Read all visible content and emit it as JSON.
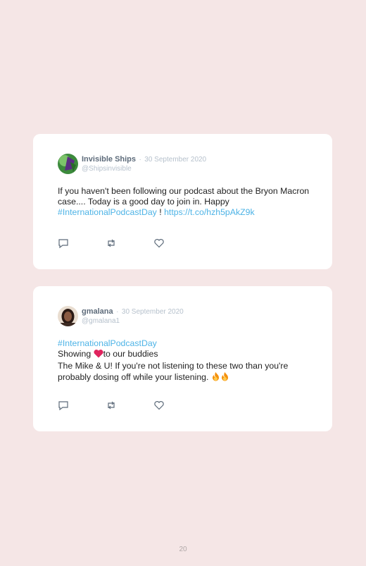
{
  "tweets": [
    {
      "name": "Invisible Ships",
      "separator": "·",
      "date": "30 September 2020",
      "handle": "@Shipsinvisible",
      "text_line": "If you haven't been following our podcast about the Bryon Macron case.... Today is a good day to join in. Happy",
      "hashtag": "#InternationalPodcastDay",
      "after_hashtag": "!",
      "link": "https://t.co/hzh5pAkZ9k"
    },
    {
      "name": "gmalana",
      "separator": "·",
      "date": "30 September 2020",
      "handle": "@gmalana1",
      "hashtag": "#InternationalPodcastDay",
      "line2_before": "Showing",
      "line2_after": "to our buddies",
      "line3": "The Mike & U! If you're not listening to these two than you're probably dosing off while your listening."
    }
  ],
  "icons": [
    "reply-icon",
    "retweet-icon",
    "like-icon",
    "heart-emoji",
    "fire-emoji"
  ],
  "colors": {
    "background": "#f5e6e6",
    "hashtag": "#4db3e6",
    "name": "#5d6b7a",
    "muted": "#b6c1cc"
  },
  "page_number": "20"
}
